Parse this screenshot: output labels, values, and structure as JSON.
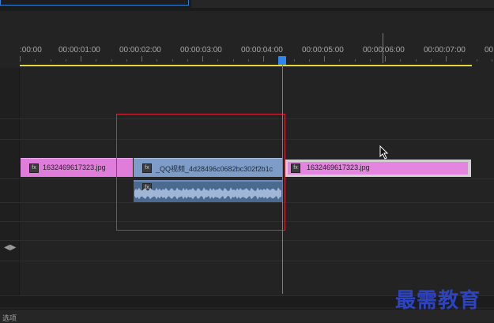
{
  "timeline": {
    "timecodes": [
      ":00:00",
      "00:00:01:00",
      "00:00:02:00",
      "00:00:03:00",
      "00:00:04:00",
      "00:00:05:00",
      "00:00:06:00",
      "00:00:07:00",
      "00"
    ],
    "playhead_time_label": ""
  },
  "clips": {
    "image_a": {
      "label": "1632469617323.jpg",
      "badge": "fx"
    },
    "video": {
      "label": "_QQ视频_4d28496c0682bc302f2b1c",
      "badge": "fx"
    },
    "image_b": {
      "label": "1632469617323.jpg",
      "badge": "fx"
    },
    "audio": {
      "badge": "fx"
    }
  },
  "status": {
    "text": "选项"
  },
  "watermark": {
    "text": "最需教育"
  },
  "colors": {
    "image_clip": "#e07ddb",
    "video_clip": "#7d9dc8",
    "audio_clip": "#4a6a92",
    "playhead": "#2c86ee",
    "work_area": "#e5d63c",
    "highlight": "#d9263a",
    "watermark": "#2c44c4"
  }
}
